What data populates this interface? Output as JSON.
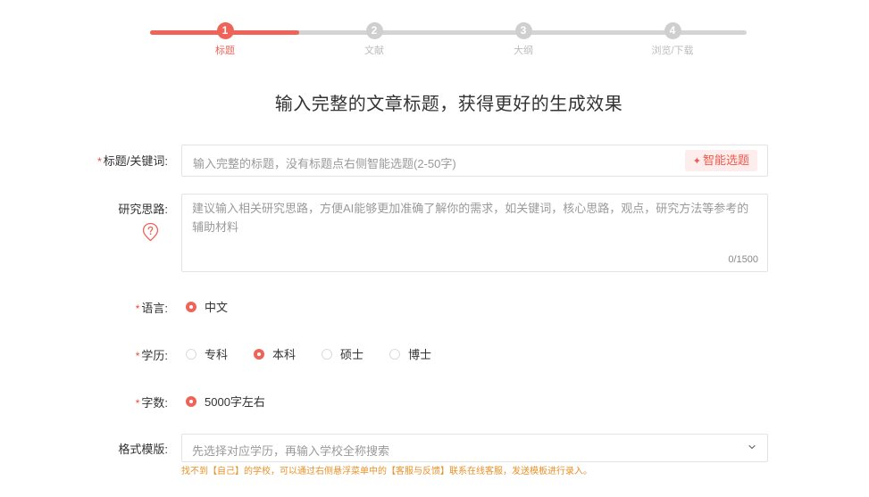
{
  "stepper": {
    "steps": [
      {
        "number": "1",
        "label": "标题"
      },
      {
        "number": "2",
        "label": "文献"
      },
      {
        "number": "3",
        "label": "大纲"
      },
      {
        "number": "4",
        "label": "浏览/下载"
      }
    ],
    "active_step": 1,
    "progress": 0.25
  },
  "page_title": "输入完整的文章标题，获得更好的生成效果",
  "form": {
    "required_mark": "*",
    "title_field": {
      "label": "标题/关键词:",
      "placeholder": "输入完整的标题，没有标题点右侧智能选题(2-50字)",
      "smart_button": "智能选题"
    },
    "idea_field": {
      "label": "研究思路:",
      "placeholder": "建议输入相关研究思路，方便AI能够更加准确了解你的需求，如关键词，核心思路，观点，研究方法等参考的辅助材料",
      "counter": "0/1500"
    },
    "language": {
      "label": "语言:",
      "options": [
        "中文"
      ],
      "selected": "中文"
    },
    "degree": {
      "label": "学历:",
      "options": [
        "专科",
        "本科",
        "硕士",
        "博士"
      ],
      "selected": "本科"
    },
    "word_count": {
      "label": "字数:",
      "options": [
        "5000字左右"
      ],
      "selected": "5000字左右"
    },
    "template": {
      "label": "格式模版:",
      "placeholder": "先选择对应学历，再输入学校全称搜索",
      "hint": "找不到【自己】的学校，可以通过右侧悬浮菜单中的【客服与反馈】联系在线客服，发送模板进行录入。"
    }
  },
  "colors": {
    "accent": "#ee6458",
    "inactive": "#d4d4d4",
    "hint": "#e6922b"
  },
  "icons": [
    "sparkle-icon",
    "question-pin-icon",
    "chevron-down-icon"
  ]
}
